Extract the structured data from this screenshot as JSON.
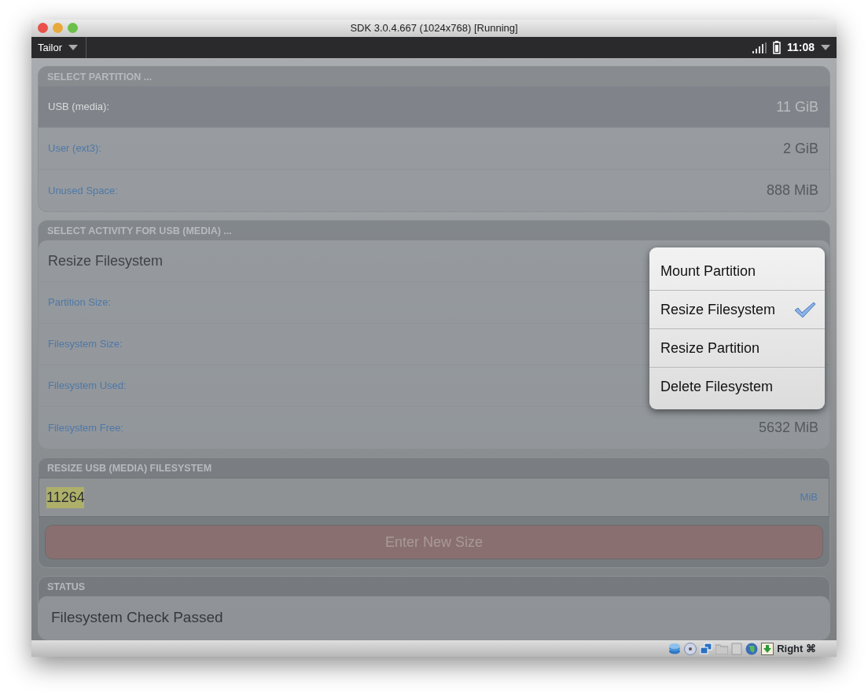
{
  "window": {
    "title": "SDK 3.0.4.667 (1024x768) [Running]"
  },
  "top_bar": {
    "app_menu": "Tailor",
    "clock": "11:08"
  },
  "partition_section": {
    "header": "SELECT PARTITION ...",
    "items": [
      {
        "label": "USB (media):",
        "value": "11 GiB",
        "selected": true
      },
      {
        "label": "User (ext3):",
        "value": "2 GiB",
        "selected": false
      },
      {
        "label": "Unused Space:",
        "value": "888 MiB",
        "selected": false
      }
    ]
  },
  "activity_section": {
    "header": "SELECT ACTIVITY FOR USB (MEDIA) ...",
    "current": "Resize Filesystem",
    "rows": [
      {
        "label": "Partition Size:"
      },
      {
        "label": "Filesystem Size:"
      },
      {
        "label": "Filesystem Used:"
      },
      {
        "label": "Filesystem Free:",
        "value": "5632 MiB"
      }
    ]
  },
  "resize_section": {
    "header": "RESIZE USB (MEDIA) FILESYSTEM",
    "input": {
      "value": "11264",
      "value_selected": true,
      "unit": "MiB"
    },
    "button": {
      "label": "Enter New Size",
      "disabled": true
    }
  },
  "status_section": {
    "header": "STATUS",
    "message": "Filesystem Check Passed"
  },
  "activity_menu": {
    "items": [
      {
        "label": "Mount Partition",
        "selected": false
      },
      {
        "label": "Resize Filesystem",
        "selected": true
      },
      {
        "label": "Resize Partition",
        "selected": false
      },
      {
        "label": "Delete Filesystem",
        "selected": false
      }
    ]
  },
  "vm_status_bar": {
    "host_key": "Right ⌘"
  }
}
